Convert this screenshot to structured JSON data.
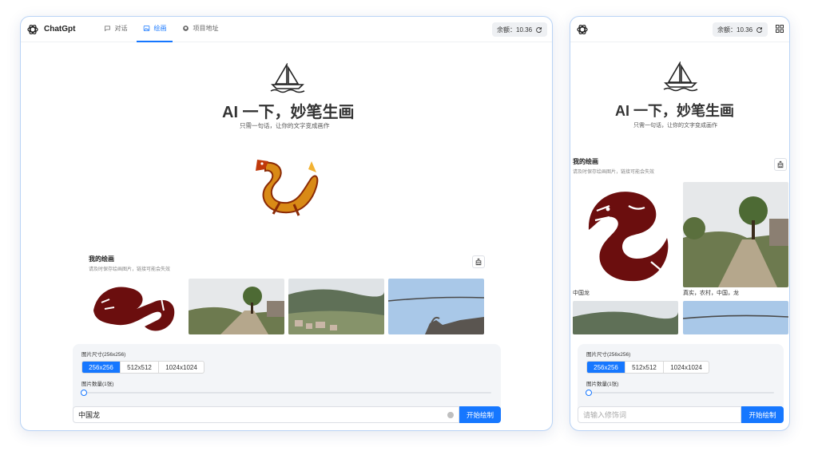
{
  "app": {
    "brand": "ChatGpt"
  },
  "tabs": [
    {
      "label": "对话",
      "icon": "chat-icon"
    },
    {
      "label": "绘画",
      "icon": "image-icon"
    },
    {
      "label": "项目地址",
      "icon": "github-icon"
    }
  ],
  "balance": {
    "text": "余额：10.36",
    "icon": "refresh-icon"
  },
  "hero": {
    "title": "AI 一下，妙笔生画",
    "subtitle": "只需一句话，让你的文字变成画作",
    "icon": "sailboat-icon"
  },
  "gallery": {
    "title": "我的绘画",
    "note": "请及时保存绘画图片，链接可能会失效",
    "clear_icon": "broom-icon",
    "items": [
      {
        "caption": "中国龙"
      },
      {
        "caption": "真实，农村，中国，龙"
      }
    ]
  },
  "settings": {
    "size_label": "图片尺寸(256x256)",
    "sizes": [
      "256x256",
      "512x512",
      "1024x1024"
    ],
    "selected_size": "256x256",
    "count_label": "图片数量(1张)",
    "count_value": 1
  },
  "prompt": {
    "desktop_value": "中国龙",
    "mobile_placeholder": "请输入修饰词",
    "submit_label": "开始绘制"
  },
  "colors": {
    "accent": "#1677ff",
    "frame": "#b9d3f5",
    "panel": "#f3f5f8",
    "dragon": "#6b0e0e"
  }
}
